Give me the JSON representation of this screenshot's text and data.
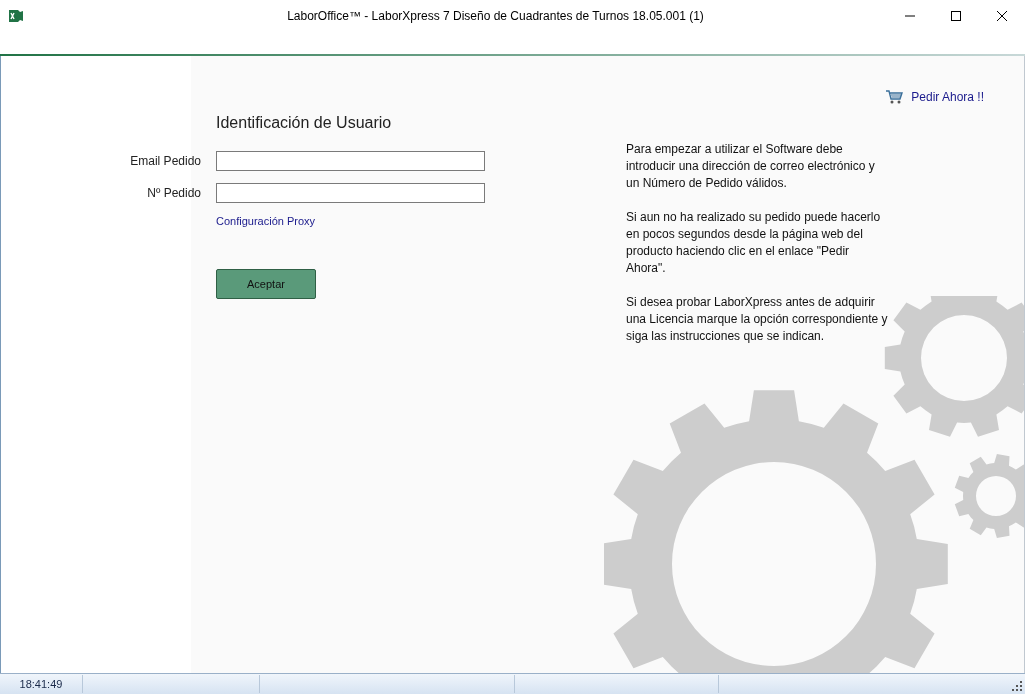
{
  "window": {
    "title": "LaborOffice™ - LaborXpress 7 Diseño de Cuadrantes de Turnos 18.05.001 (1)"
  },
  "order_link": "Pedir Ahora !!",
  "form": {
    "heading": "Identificación de Usuario",
    "fields": [
      {
        "label": "Email Pedido"
      },
      {
        "label": "Nº Pedido"
      }
    ],
    "proxy_link": "Configuración Proxy",
    "submit": "Aceptar"
  },
  "info": [
    "Para empezar a utilizar el Software debe introducir una dirección de correo electrónico y un Número de Pedido válidos.",
    "Si aun no ha realizado su pedido puede hacerlo en pocos segundos desde la página web del producto haciendo clic en el enlace \"Pedir Ahora\".",
    "Si desea probar LaborXpress antes de adquirir una Licencia marque la opción correspondiente y siga las instrucciones que se indican."
  ],
  "status_bar": {
    "time": "18:41:49"
  }
}
